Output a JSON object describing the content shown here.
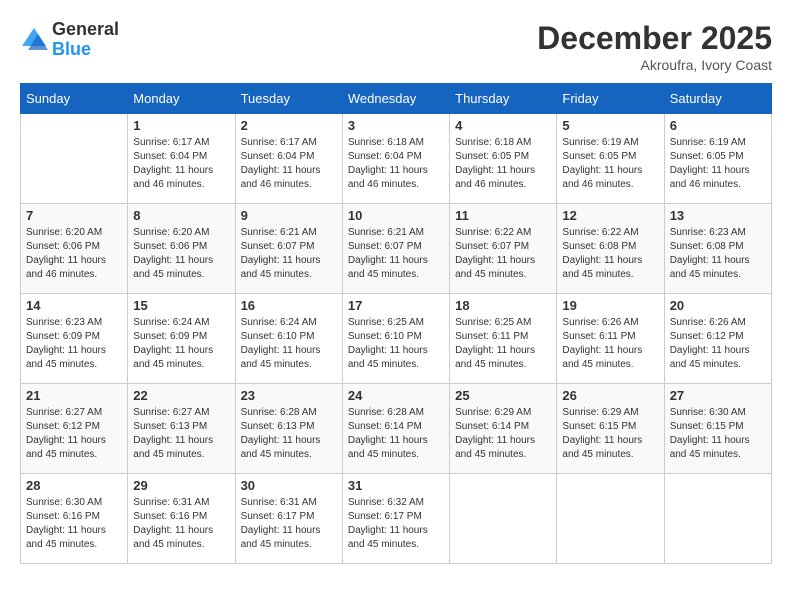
{
  "header": {
    "logo_general": "General",
    "logo_blue": "Blue",
    "month_title": "December 2025",
    "location": "Akroufra, Ivory Coast"
  },
  "days_of_week": [
    "Sunday",
    "Monday",
    "Tuesday",
    "Wednesday",
    "Thursday",
    "Friday",
    "Saturday"
  ],
  "weeks": [
    [
      {
        "day": "",
        "sunrise": "",
        "sunset": "",
        "daylight": ""
      },
      {
        "day": "1",
        "sunrise": "Sunrise: 6:17 AM",
        "sunset": "Sunset: 6:04 PM",
        "daylight": "Daylight: 11 hours and 46 minutes."
      },
      {
        "day": "2",
        "sunrise": "Sunrise: 6:17 AM",
        "sunset": "Sunset: 6:04 PM",
        "daylight": "Daylight: 11 hours and 46 minutes."
      },
      {
        "day": "3",
        "sunrise": "Sunrise: 6:18 AM",
        "sunset": "Sunset: 6:04 PM",
        "daylight": "Daylight: 11 hours and 46 minutes."
      },
      {
        "day": "4",
        "sunrise": "Sunrise: 6:18 AM",
        "sunset": "Sunset: 6:05 PM",
        "daylight": "Daylight: 11 hours and 46 minutes."
      },
      {
        "day": "5",
        "sunrise": "Sunrise: 6:19 AM",
        "sunset": "Sunset: 6:05 PM",
        "daylight": "Daylight: 11 hours and 46 minutes."
      },
      {
        "day": "6",
        "sunrise": "Sunrise: 6:19 AM",
        "sunset": "Sunset: 6:05 PM",
        "daylight": "Daylight: 11 hours and 46 minutes."
      }
    ],
    [
      {
        "day": "7",
        "sunrise": "Sunrise: 6:20 AM",
        "sunset": "Sunset: 6:06 PM",
        "daylight": "Daylight: 11 hours and 46 minutes."
      },
      {
        "day": "8",
        "sunrise": "Sunrise: 6:20 AM",
        "sunset": "Sunset: 6:06 PM",
        "daylight": "Daylight: 11 hours and 45 minutes."
      },
      {
        "day": "9",
        "sunrise": "Sunrise: 6:21 AM",
        "sunset": "Sunset: 6:07 PM",
        "daylight": "Daylight: 11 hours and 45 minutes."
      },
      {
        "day": "10",
        "sunrise": "Sunrise: 6:21 AM",
        "sunset": "Sunset: 6:07 PM",
        "daylight": "Daylight: 11 hours and 45 minutes."
      },
      {
        "day": "11",
        "sunrise": "Sunrise: 6:22 AM",
        "sunset": "Sunset: 6:07 PM",
        "daylight": "Daylight: 11 hours and 45 minutes."
      },
      {
        "day": "12",
        "sunrise": "Sunrise: 6:22 AM",
        "sunset": "Sunset: 6:08 PM",
        "daylight": "Daylight: 11 hours and 45 minutes."
      },
      {
        "day": "13",
        "sunrise": "Sunrise: 6:23 AM",
        "sunset": "Sunset: 6:08 PM",
        "daylight": "Daylight: 11 hours and 45 minutes."
      }
    ],
    [
      {
        "day": "14",
        "sunrise": "Sunrise: 6:23 AM",
        "sunset": "Sunset: 6:09 PM",
        "daylight": "Daylight: 11 hours and 45 minutes."
      },
      {
        "day": "15",
        "sunrise": "Sunrise: 6:24 AM",
        "sunset": "Sunset: 6:09 PM",
        "daylight": "Daylight: 11 hours and 45 minutes."
      },
      {
        "day": "16",
        "sunrise": "Sunrise: 6:24 AM",
        "sunset": "Sunset: 6:10 PM",
        "daylight": "Daylight: 11 hours and 45 minutes."
      },
      {
        "day": "17",
        "sunrise": "Sunrise: 6:25 AM",
        "sunset": "Sunset: 6:10 PM",
        "daylight": "Daylight: 11 hours and 45 minutes."
      },
      {
        "day": "18",
        "sunrise": "Sunrise: 6:25 AM",
        "sunset": "Sunset: 6:11 PM",
        "daylight": "Daylight: 11 hours and 45 minutes."
      },
      {
        "day": "19",
        "sunrise": "Sunrise: 6:26 AM",
        "sunset": "Sunset: 6:11 PM",
        "daylight": "Daylight: 11 hours and 45 minutes."
      },
      {
        "day": "20",
        "sunrise": "Sunrise: 6:26 AM",
        "sunset": "Sunset: 6:12 PM",
        "daylight": "Daylight: 11 hours and 45 minutes."
      }
    ],
    [
      {
        "day": "21",
        "sunrise": "Sunrise: 6:27 AM",
        "sunset": "Sunset: 6:12 PM",
        "daylight": "Daylight: 11 hours and 45 minutes."
      },
      {
        "day": "22",
        "sunrise": "Sunrise: 6:27 AM",
        "sunset": "Sunset: 6:13 PM",
        "daylight": "Daylight: 11 hours and 45 minutes."
      },
      {
        "day": "23",
        "sunrise": "Sunrise: 6:28 AM",
        "sunset": "Sunset: 6:13 PM",
        "daylight": "Daylight: 11 hours and 45 minutes."
      },
      {
        "day": "24",
        "sunrise": "Sunrise: 6:28 AM",
        "sunset": "Sunset: 6:14 PM",
        "daylight": "Daylight: 11 hours and 45 minutes."
      },
      {
        "day": "25",
        "sunrise": "Sunrise: 6:29 AM",
        "sunset": "Sunset: 6:14 PM",
        "daylight": "Daylight: 11 hours and 45 minutes."
      },
      {
        "day": "26",
        "sunrise": "Sunrise: 6:29 AM",
        "sunset": "Sunset: 6:15 PM",
        "daylight": "Daylight: 11 hours and 45 minutes."
      },
      {
        "day": "27",
        "sunrise": "Sunrise: 6:30 AM",
        "sunset": "Sunset: 6:15 PM",
        "daylight": "Daylight: 11 hours and 45 minutes."
      }
    ],
    [
      {
        "day": "28",
        "sunrise": "Sunrise: 6:30 AM",
        "sunset": "Sunset: 6:16 PM",
        "daylight": "Daylight: 11 hours and 45 minutes."
      },
      {
        "day": "29",
        "sunrise": "Sunrise: 6:31 AM",
        "sunset": "Sunset: 6:16 PM",
        "daylight": "Daylight: 11 hours and 45 minutes."
      },
      {
        "day": "30",
        "sunrise": "Sunrise: 6:31 AM",
        "sunset": "Sunset: 6:17 PM",
        "daylight": "Daylight: 11 hours and 45 minutes."
      },
      {
        "day": "31",
        "sunrise": "Sunrise: 6:32 AM",
        "sunset": "Sunset: 6:17 PM",
        "daylight": "Daylight: 11 hours and 45 minutes."
      },
      {
        "day": "",
        "sunrise": "",
        "sunset": "",
        "daylight": ""
      },
      {
        "day": "",
        "sunrise": "",
        "sunset": "",
        "daylight": ""
      },
      {
        "day": "",
        "sunrise": "",
        "sunset": "",
        "daylight": ""
      }
    ]
  ]
}
